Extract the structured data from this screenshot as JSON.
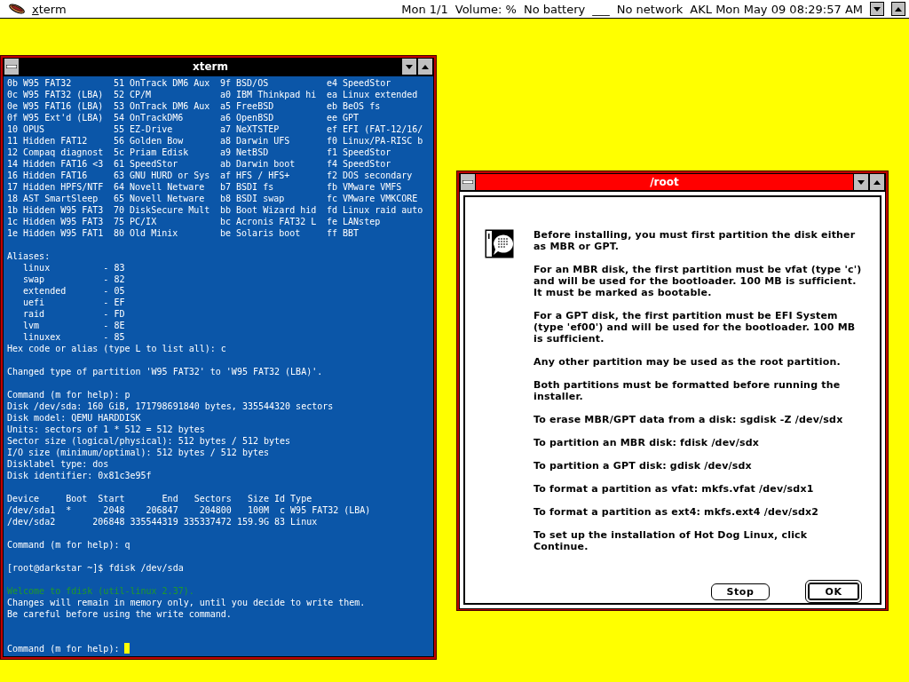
{
  "menubar": {
    "app": "xterm",
    "status": [
      "Mon 1/1",
      "Volume: %",
      "No battery",
      "___",
      "No network",
      "AKL Mon May 09 08:29:57 AM"
    ]
  },
  "terminal": {
    "title": "xterm",
    "active": true,
    "partition_types": [
      [
        "0b W95 FAT32",
        "51 OnTrack DM6 Aux",
        "9f BSD/OS",
        "e4 SpeedStor"
      ],
      [
        "0c W95 FAT32 (LBA)",
        "52 CP/M",
        "a0 IBM Thinkpad hi",
        "ea Linux extended"
      ],
      [
        "0e W95 FAT16 (LBA)",
        "53 OnTrack DM6 Aux",
        "a5 FreeBSD",
        "eb BeOS fs"
      ],
      [
        "0f W95 Ext'd (LBA)",
        "54 OnTrackDM6",
        "a6 OpenBSD",
        "ee GPT"
      ],
      [
        "10 OPUS",
        "55 EZ-Drive",
        "a7 NeXTSTEP",
        "ef EFI (FAT-12/16/"
      ],
      [
        "11 Hidden FAT12",
        "56 Golden Bow",
        "a8 Darwin UFS",
        "f0 Linux/PA-RISC b"
      ],
      [
        "12 Compaq diagnost",
        "5c Priam Edisk",
        "a9 NetBSD",
        "f1 SpeedStor"
      ],
      [
        "14 Hidden FAT16 <3",
        "61 SpeedStor",
        "ab Darwin boot",
        "f4 SpeedStor"
      ],
      [
        "16 Hidden FAT16",
        "63 GNU HURD or Sys",
        "af HFS / HFS+",
        "f2 DOS secondary"
      ],
      [
        "17 Hidden HPFS/NTF",
        "64 Novell Netware",
        "b7 BSDI fs",
        "fb VMware VMFS"
      ],
      [
        "18 AST SmartSleep",
        "65 Novell Netware",
        "b8 BSDI swap",
        "fc VMware VMKCORE"
      ],
      [
        "1b Hidden W95 FAT3",
        "70 DiskSecure Mult",
        "bb Boot Wizard hid",
        "fd Linux raid auto"
      ],
      [
        "1c Hidden W95 FAT3",
        "75 PC/IX",
        "bc Acronis FAT32 L",
        "fe LANstep"
      ],
      [
        "1e Hidden W95 FAT1",
        "80 Old Minix",
        "be Solaris boot",
        "ff BBT"
      ]
    ],
    "lines": [
      {
        "kind": "blank"
      },
      {
        "kind": "output",
        "text": "Aliases:"
      },
      {
        "kind": "output",
        "text": "   linux          - 83"
      },
      {
        "kind": "output",
        "text": "   swap           - 82"
      },
      {
        "kind": "output",
        "text": "   extended       - 05"
      },
      {
        "kind": "output",
        "text": "   uefi           - EF"
      },
      {
        "kind": "output",
        "text": "   raid           - FD"
      },
      {
        "kind": "output",
        "text": "   lvm            - 8E"
      },
      {
        "kind": "output",
        "text": "   linuxex        - 85"
      },
      {
        "kind": "output",
        "text": "Hex code or alias (type L to list all): c"
      },
      {
        "kind": "blank"
      },
      {
        "kind": "output",
        "text": "Changed type of partition 'W95 FAT32' to 'W95 FAT32 (LBA)'."
      },
      {
        "kind": "blank"
      },
      {
        "kind": "output",
        "text": "Command (m for help): p"
      },
      {
        "kind": "output",
        "text": "Disk /dev/sda: 160 GiB, 171798691840 bytes, 335544320 sectors"
      },
      {
        "kind": "output",
        "text": "Disk model: QEMU HARDDISK"
      },
      {
        "kind": "output",
        "text": "Units: sectors of 1 * 512 = 512 bytes"
      },
      {
        "kind": "output",
        "text": "Sector size (logical/physical): 512 bytes / 512 bytes"
      },
      {
        "kind": "output",
        "text": "I/O size (minimum/optimal): 512 bytes / 512 bytes"
      },
      {
        "kind": "output",
        "text": "Disklabel type: dos"
      },
      {
        "kind": "output",
        "text": "Disk identifier: 0x81c3e95f"
      },
      {
        "kind": "blank"
      },
      {
        "kind": "output",
        "text": "Device     Boot  Start       End   Sectors   Size Id Type"
      },
      {
        "kind": "output",
        "text": "/dev/sda1  *      2048    206847    204800   100M  c W95 FAT32 (LBA)"
      },
      {
        "kind": "output",
        "text": "/dev/sda2       206848 335544319 335337472 159.9G 83 Linux"
      },
      {
        "kind": "blank"
      },
      {
        "kind": "output",
        "text": "Command (m for help): q"
      },
      {
        "kind": "blank"
      },
      {
        "kind": "output",
        "text": "[root@darkstar ~]$ fdisk /dev/sda"
      },
      {
        "kind": "blank"
      },
      {
        "kind": "notice",
        "text": "Welcome to fdisk (util-linux 2.37)."
      },
      {
        "kind": "output",
        "text": "Changes will remain in memory only, until you decide to write them."
      },
      {
        "kind": "output",
        "text": "Be careful before using the write command."
      },
      {
        "kind": "blank"
      },
      {
        "kind": "blank"
      },
      {
        "kind": "prompt",
        "text": "Command (m for help): "
      }
    ]
  },
  "dialog": {
    "title": "/root",
    "paragraphs": [
      "Before installing, you must first partition the disk either as MBR or GPT.",
      "For an MBR disk, the first partition must be vfat (type 'c') and will be used for the bootloader. 100 MB is sufficient. It must be marked as bootable.",
      "For a GPT disk, the first partition must be EFI System (type 'ef00') and will be used for the bootloader. 100 MB is sufficient.",
      "Any other partition may be used as the root partition.",
      "Both partitions must be formatted before running the installer.",
      "To erase MBR/GPT data from a disk: sgdisk -Z /dev/sdx",
      "To partition an MBR disk: fdisk /dev/sdx",
      "To partition a GPT disk: gdisk /dev/sdx",
      "To format a partition as vfat: mkfs.vfat /dev/sdx1",
      "To format a partition as ext4: mkfs.ext4 /dev/sdx2",
      "To set up the installation of Hot Dog Linux, click Continue."
    ],
    "buttons": [
      {
        "label": "Stop",
        "default": false
      },
      {
        "label": "OK",
        "default": true
      }
    ]
  }
}
